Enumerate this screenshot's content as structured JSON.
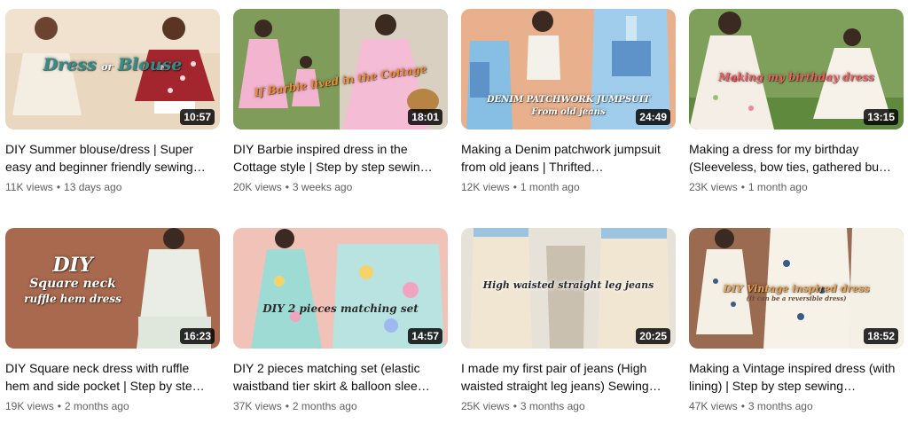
{
  "videos": [
    {
      "duration": "10:57",
      "title": "DIY Summer blouse/dress | Super easy and beginner friendly sewing…",
      "views": "11K views",
      "age": "13 days ago",
      "overlay": [
        "Dress",
        "or",
        "Blouse"
      ],
      "colors": {
        "bg": "#ead7c0",
        "accent": "#a3262e",
        "text": "#2f8f8b"
      }
    },
    {
      "duration": "18:01",
      "title": "DIY Barbie inspired dress in the Cottage style | Step by step sewin…",
      "views": "20K views",
      "age": "3 weeks ago",
      "overlay": [
        "If Barbie lived in the Cottage"
      ],
      "colors": {
        "bg": "#6f8f4e",
        "accent": "#f3b6d0",
        "text": "#f08a2c"
      }
    },
    {
      "duration": "24:49",
      "title": "Making a Denim patchwork jumpsuit from old jeans | Thrifted…",
      "views": "12K views",
      "age": "1 month ago",
      "overlay": [
        "DENIM PATCHWORK JUMPSUIT",
        "From old jeans"
      ],
      "colors": {
        "bg": "#e8b08d",
        "accent": "#86bfe3",
        "text": "#ffffff"
      }
    },
    {
      "duration": "13:15",
      "title": "Making a dress for my birthday (Sleeveless, bow ties, gathered bu…",
      "views": "23K views",
      "age": "1 month ago",
      "overlay": [
        "Making my birthday dress"
      ],
      "colors": {
        "bg": "#7fa05a",
        "accent": "#f4eee6",
        "text": "#f05c5c"
      }
    },
    {
      "duration": "16:23",
      "title": "DIY Square neck dress with ruffle hem and side pocket | Step by ste…",
      "views": "19K views",
      "age": "2 months ago",
      "overlay": [
        "DIY",
        "Square neck",
        "ruffle hem dress"
      ],
      "colors": {
        "bg": "#a9694e",
        "accent": "#e9ede6",
        "text": "#ffffff"
      }
    },
    {
      "duration": "14:57",
      "title": "DIY 2 pieces matching set (elastic waistband tier skirt & balloon slee…",
      "views": "37K views",
      "age": "2 months ago",
      "overlay": [
        "DIY 2 pieces matching set"
      ],
      "colors": {
        "bg": "#f1c3b8",
        "accent": "#9edbd5",
        "text": "#2a2a2a"
      }
    },
    {
      "duration": "20:25",
      "title": "I made my first pair of jeans (High waisted straight leg jeans) Sewing…",
      "views": "25K views",
      "age": "3 months ago",
      "overlay": [
        "High waisted straight leg jeans"
      ],
      "colors": {
        "bg": "#e7e2d8",
        "accent": "#f1e6d2",
        "text": "#2a2a2a"
      }
    },
    {
      "duration": "18:52",
      "title": "Making a Vintage inspired dress (with lining) | Step by step sewing…",
      "views": "47K views",
      "age": "3 months ago",
      "overlay": [
        "DIY Vintage inspired dress",
        "(It can be a reversible dress)"
      ],
      "colors": {
        "bg": "#9a6a51",
        "accent": "#f4f0e6",
        "text": "#e9a04d"
      }
    }
  ]
}
